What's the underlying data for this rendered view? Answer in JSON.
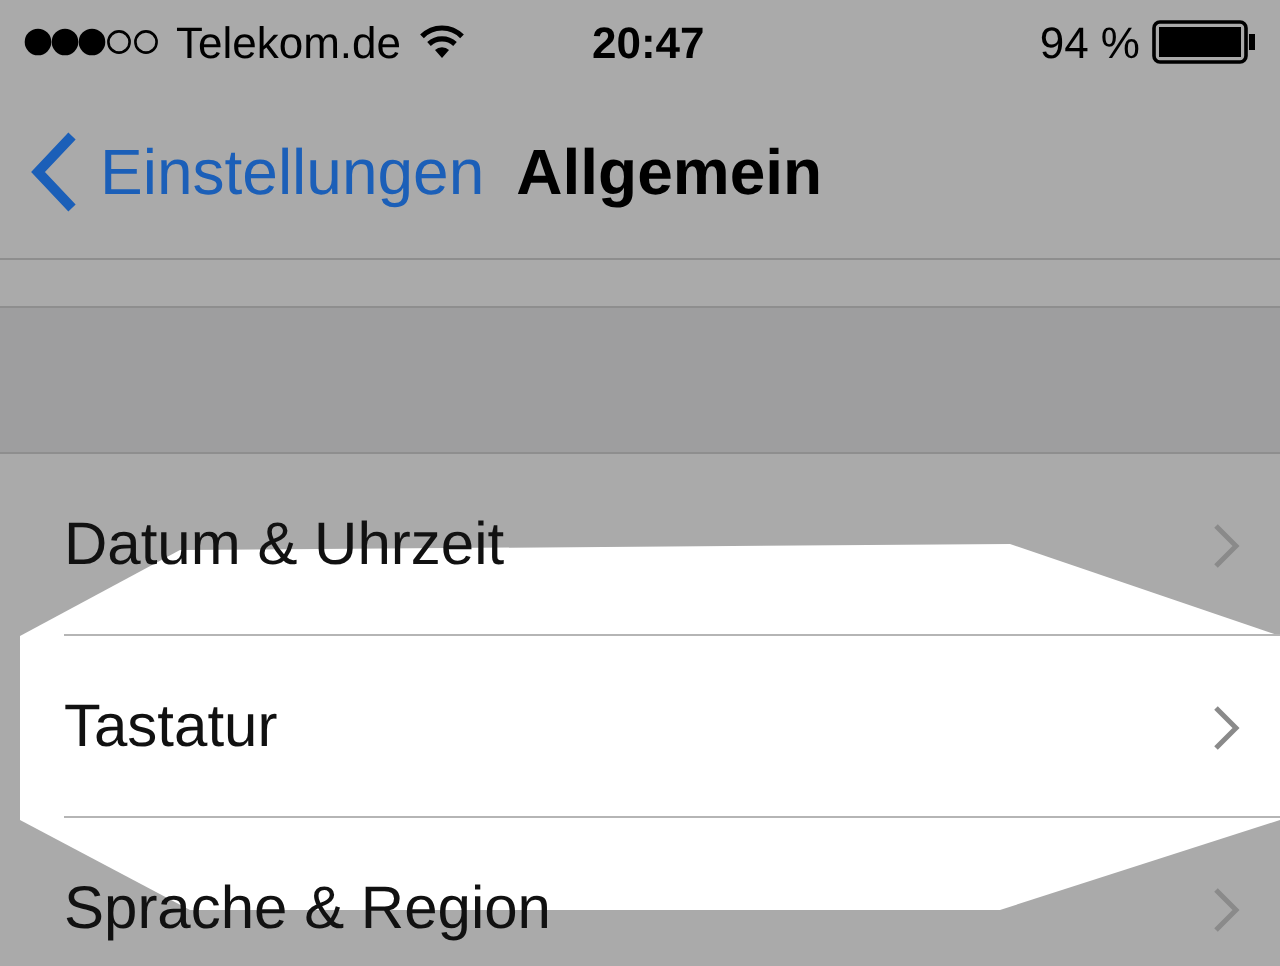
{
  "status_bar": {
    "carrier": "Telekom.de",
    "time": "20:47",
    "battery": "94 %"
  },
  "nav": {
    "back": "Einstellungen",
    "title": "Allgemein"
  },
  "rows": [
    {
      "label": "Datum & Uhrzeit",
      "highlighted": false
    },
    {
      "label": "Tastatur",
      "highlighted": true
    },
    {
      "label": "Sprache & Region",
      "highlighted": false
    }
  ]
}
